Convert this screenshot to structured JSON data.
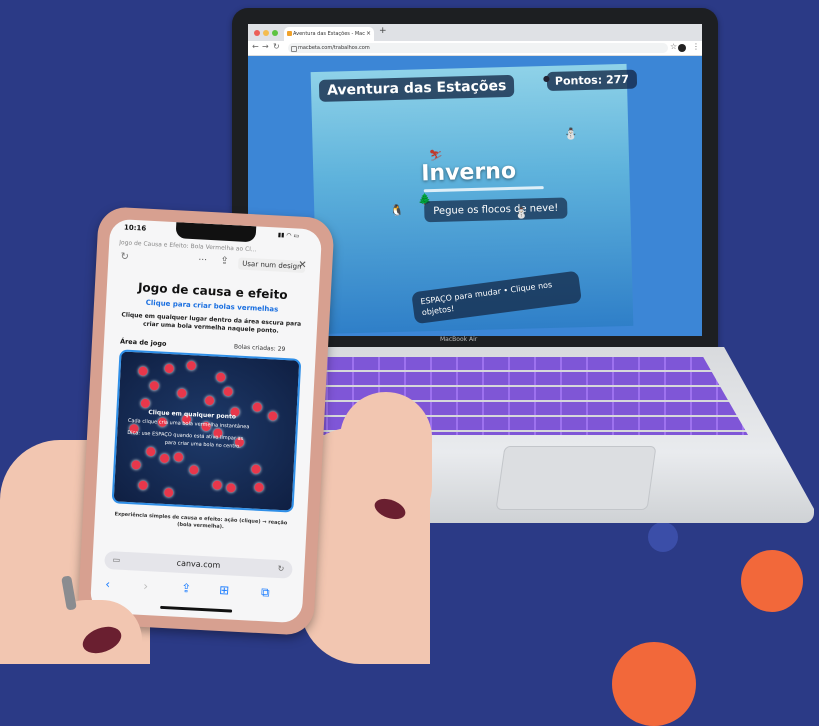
{
  "colors": {
    "background": "#2b3a86",
    "accent_orange": "#f2683a",
    "keyboard": "#7a4fd6",
    "ball_red": "#e8374b",
    "link_blue": "#1a6fe0"
  },
  "laptop": {
    "brand": "MacBook Air",
    "browser": {
      "tab_title": "Aventura das Estações - Mac",
      "tab_close": "×",
      "new_tab": "+",
      "url": "macbeta.com/trabalhos.com"
    },
    "game": {
      "title": "Aventura das Estações",
      "score": "Pontos: 277",
      "season": "Inverno",
      "hint": "Pegue os flocos de neve!",
      "controls": "ESPAÇO para mudar • Clique nos objetos!"
    }
  },
  "phone": {
    "time": "10:16",
    "status_icons": "▮▮ ◠ ▭",
    "tab_text": "Jogo de Causa e Efeito: Bola Vermelha ao Cl...",
    "use_design_label": "Usar num design",
    "app": {
      "title": "Jogo de causa e efeito",
      "subtitle": "Clique para criar bolas vermelhas",
      "instructions": "Clique em qualquer lugar dentro da área escura para criar uma bola vermelha naquele ponto.",
      "area_label": "Área de jogo",
      "balls_counter": "Bolas criadas: 29",
      "overlay_line1": "Clique em qualquer ponto",
      "overlay_line2": "Cada clique cria uma bola vermelha instantânea",
      "overlay_line3": "Dica: use ESPAÇO quando está ativo limpar as",
      "overlay_line4": "para criar uma bola no centro.",
      "footer": "Experiência simples de causa e efeito: ação (clique) → reação (bola vermelha)."
    },
    "address": "canva.com"
  }
}
